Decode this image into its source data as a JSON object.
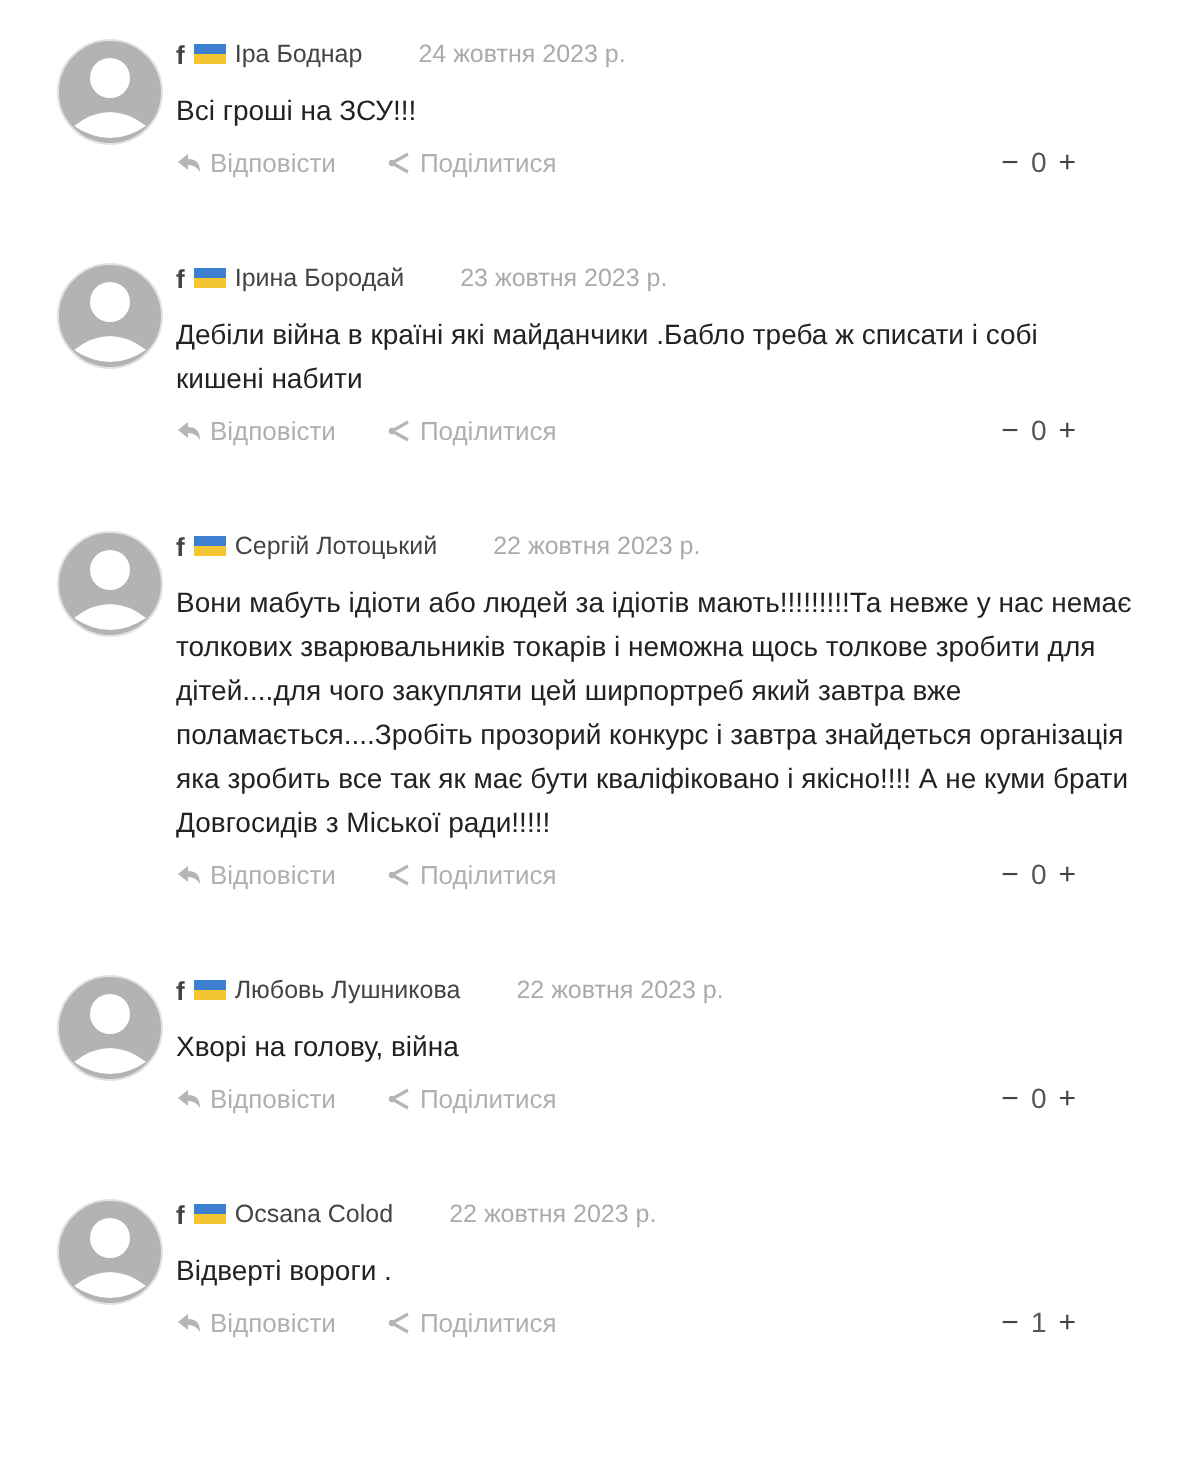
{
  "comments": [
    {
      "network": "f",
      "author": "Іра Боднар",
      "date": "24 жовтня 2023 р.",
      "text": "Всі гроші на ЗСУ!!!",
      "reply": "Відповісти",
      "share": "Поділитися",
      "minus": "−",
      "score": "0",
      "plus": "+"
    },
    {
      "network": "f",
      "author": "Ірина Бородай",
      "date": "23 жовтня 2023 р.",
      "text": "Дебіли  війна в країні які майданчики .Бабло треба ж списати і собі кишені набити",
      "reply": "Відповісти",
      "share": "Поділитися",
      "minus": "−",
      "score": "0",
      "plus": "+"
    },
    {
      "network": "f",
      "author": "Сергій Лотоцький",
      "date": "22 жовтня 2023 р.",
      "text": "Вони мабуть ідіоти або людей за ідіотів мають!!!!!!!!!Та невже у нас немає толкових зварювальників токарів і неможна щось толкове зробити для дітей....для чого закупляти цей ширпортреб який завтра вже поламається....Зробіть прозорий конкурс і завтра знайдеться організація яка зробить все так як має бути кваліфіковано і якісно!!!! А не куми брати Довгосидів з Міської ради!!!!!",
      "reply": "Відповісти",
      "share": "Поділитися",
      "minus": "−",
      "score": "0",
      "plus": "+"
    },
    {
      "network": "f",
      "author": "Любовь Лушникова",
      "date": "22 жовтня 2023 р.",
      "text": "Хворі на голову, війна",
      "reply": "Відповісти",
      "share": "Поділитися",
      "minus": "−",
      "score": "0",
      "plus": "+"
    },
    {
      "network": "f",
      "author": "Ocsana Colod",
      "date": "22 жовтня 2023 р.",
      "text": "Відверті вороги .",
      "reply": "Відповісти",
      "share": "Поділитися",
      "minus": "−",
      "score": "1",
      "plus": "+"
    }
  ]
}
